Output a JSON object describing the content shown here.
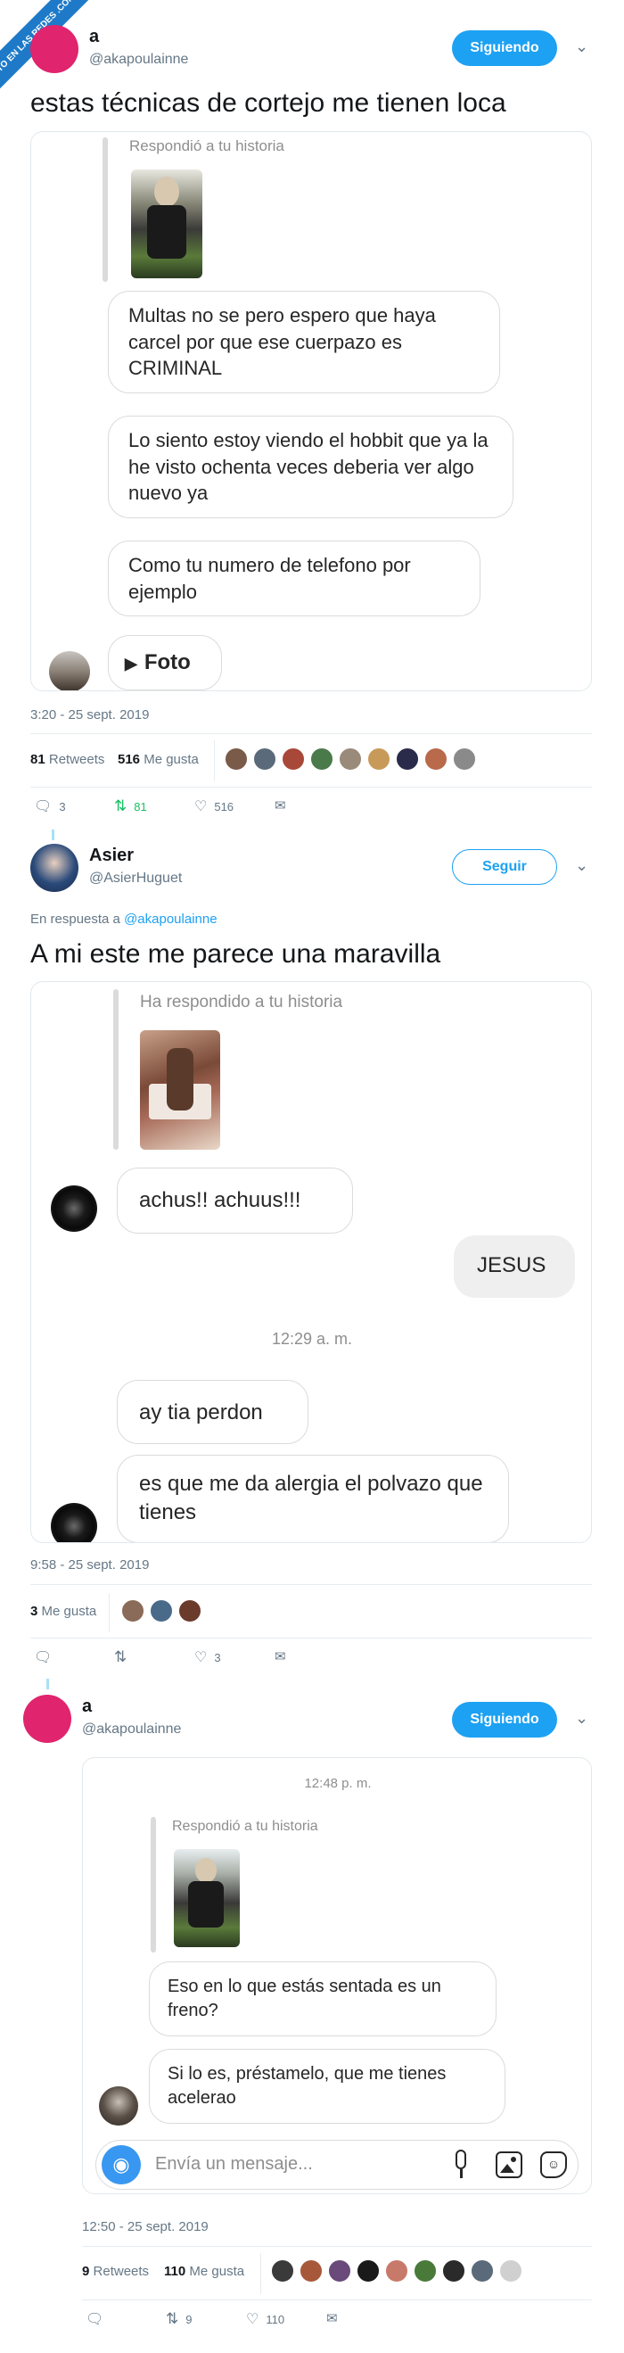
{
  "watermark": "VISTO EN LAS REDES .COM",
  "tweet1": {
    "name": "a",
    "handle": "@akapoulainne",
    "follow_label": "Siguiendo",
    "text": "estas técnicas de cortejo me tienen loca",
    "card": {
      "reply_label": "Respondió a tu historia",
      "messages": [
        "Multas no se pero espero que haya carcel por que ese cuerpazo es CRIMINAL",
        "Lo siento estoy viendo el hobbit que ya la he visto ochenta veces deberia ver algo nuevo ya",
        "Como tu numero de telefono por ejemplo"
      ],
      "foto_label": "Foto"
    },
    "timestamp": "3:20 - 25 sept. 2019",
    "retweets_count": "81",
    "retweets_label": "Retweets",
    "likes_count": "516",
    "likes_label": "Me gusta",
    "actions": {
      "replies": "3",
      "retweets": "81",
      "likes": "516"
    }
  },
  "tweet2": {
    "name": "Asier",
    "handle": "@AsierHuguet",
    "follow_label": "Seguir",
    "reply_prefix": "En respuesta a",
    "reply_to": "@akapoulainne",
    "text": "A mi este me parece una maravilla",
    "card": {
      "reply_label": "Ha respondido a tu historia",
      "msg1": "achus!! achuus!!!",
      "msg_right": "JESUS",
      "time": "12:29 a. m.",
      "msg2": "ay tia perdon",
      "msg3": "es que me da alergia el polvazo que tienes"
    },
    "timestamp": "9:58 - 25 sept. 2019",
    "likes_count": "3",
    "likes_label": "Me gusta",
    "actions": {
      "replies": "",
      "retweets": "",
      "likes": "3"
    }
  },
  "tweet3": {
    "name": "a",
    "handle": "@akapoulainne",
    "follow_label": "Siguiendo",
    "card": {
      "time": "12:48 p. m.",
      "reply_label": "Respondió a tu historia",
      "msg1": "Eso en lo que estás sentada es un freno?",
      "msg2": "Si lo es, préstamelo, que me tienes acelerao",
      "input_placeholder": "Envía un mensaje..."
    },
    "timestamp": "12:50 - 25 sept. 2019",
    "retweets_count": "9",
    "retweets_label": "Retweets",
    "likes_count": "110",
    "likes_label": "Me gusta",
    "actions": {
      "replies": "",
      "retweets": "9",
      "likes": "110"
    }
  },
  "colors": {
    "accent": "#1da1f2",
    "avatar_pink": "#e0246d",
    "retweet_green": "#17bf63"
  },
  "icons": [
    "reply-icon",
    "retweet-icon",
    "heart-icon",
    "mail-icon",
    "chevron-down-icon",
    "play-icon",
    "camera-icon",
    "mic-icon",
    "gallery-icon",
    "sticker-icon"
  ]
}
